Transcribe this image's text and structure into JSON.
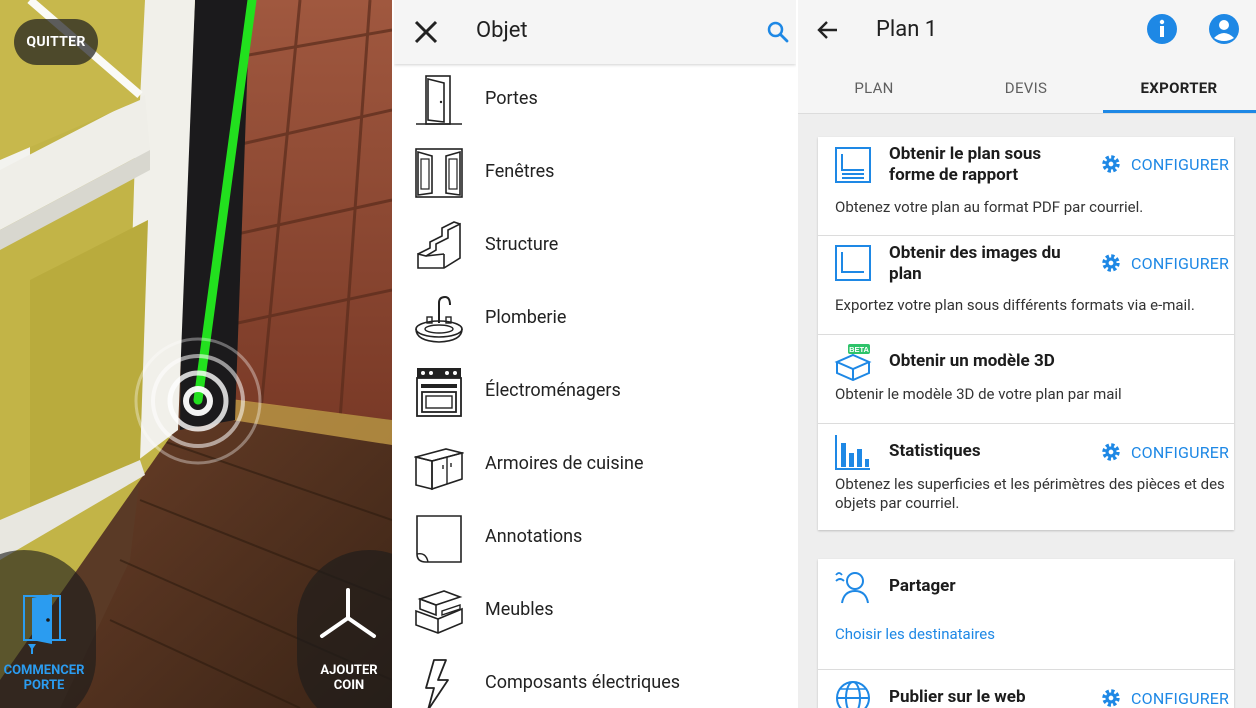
{
  "ar_view": {
    "quit_label": "QUITTER",
    "start_door_label": "COMMENCER\nPORTE",
    "add_corner_label": "AJOUTER\nCOIN",
    "colors": {
      "laser": "#22e01e",
      "door_accent": "#2b9cf0"
    }
  },
  "object_panel": {
    "title": "Objet",
    "items": [
      {
        "label": "Portes",
        "icon": "door-icon"
      },
      {
        "label": "Fenêtres",
        "icon": "window-icon"
      },
      {
        "label": "Structure",
        "icon": "stairs-icon"
      },
      {
        "label": "Plomberie",
        "icon": "sink-icon"
      },
      {
        "label": "Électroménagers",
        "icon": "stove-icon"
      },
      {
        "label": "Armoires de cuisine",
        "icon": "cabinet-icon"
      },
      {
        "label": "Annotations",
        "icon": "note-icon"
      },
      {
        "label": "Meubles",
        "icon": "sofa-icon"
      },
      {
        "label": "Composants électriques",
        "icon": "lightning-icon"
      }
    ]
  },
  "plan_panel": {
    "title": "Plan 1",
    "tabs": [
      "PLAN",
      "DEVIS",
      "EXPORTER"
    ],
    "active_tab": "EXPORTER",
    "accent": "#1e88e5",
    "config_label": "CONFIGURER",
    "export_items": [
      {
        "title": "Obtenir le plan sous forme de rapport",
        "description": "Obtenez votre plan au format PDF par courriel.",
        "configurable": true
      },
      {
        "title": "Obtenir des images du plan",
        "description": "Exportez votre plan sous différents formats via e-mail.",
        "configurable": true
      },
      {
        "title": "Obtenir un modèle 3D",
        "description": "Obtenir le modèle 3D de votre plan par mail",
        "badge": "BETA",
        "configurable": false
      },
      {
        "title": "Statistiques",
        "description": "Obtenez les superficies et les périmètres des pièces et des objets par courriel.",
        "configurable": true
      }
    ],
    "share": {
      "title": "Partager",
      "link": "Choisir les destinataires"
    },
    "publish": {
      "title": "Publier sur le web"
    }
  }
}
